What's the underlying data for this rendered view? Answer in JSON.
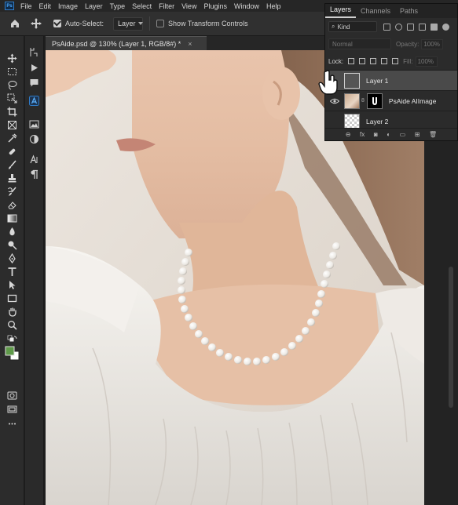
{
  "menu": {
    "logo": "Ps",
    "items": [
      "File",
      "Edit",
      "Image",
      "Layer",
      "Type",
      "Select",
      "Filter",
      "View",
      "Plugins",
      "Window",
      "Help"
    ]
  },
  "options": {
    "auto_select_label": "Auto-Select:",
    "auto_select_checked": true,
    "target_value": "Layer",
    "transform_label": "Show Transform Controls"
  },
  "document": {
    "tab_title": "PsAide.psd @ 130% (Layer 1, RGB/8#) *",
    "close": "×"
  },
  "layers_panel": {
    "tabs": [
      "Layers",
      "Channels",
      "Paths"
    ],
    "kind_label": "Kind",
    "blend_mode": "Normal",
    "opacity_label": "Opacity:",
    "opacity_value": "100%",
    "lock_label": "Lock:",
    "fill_label": "Fill:",
    "fill_value": "100%",
    "layers": [
      {
        "name": "Layer 1",
        "selected": true
      },
      {
        "name": "PsAide AIImage",
        "selected": false
      },
      {
        "name": "Layer 2",
        "selected": false
      }
    ],
    "footer": [
      "link-icon",
      "fx",
      "mask-icon",
      "adjustment-icon",
      "folder-icon",
      "new-layer-icon",
      "trash-icon"
    ]
  },
  "colors": {
    "foreground": "#5f9a4a",
    "background": "#ffffff",
    "accent": "#2f7cc9"
  }
}
